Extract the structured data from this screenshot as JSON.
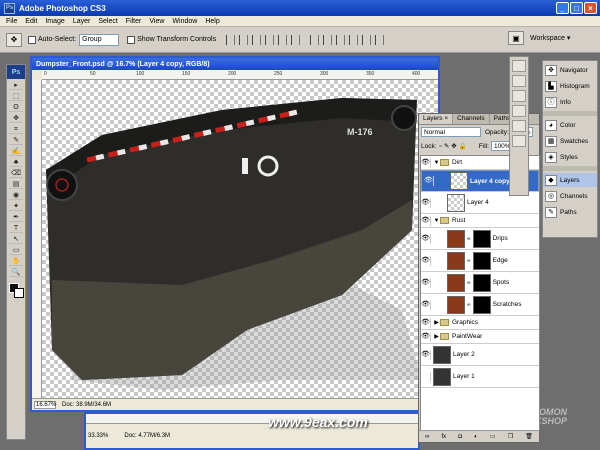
{
  "app": {
    "title": "Adobe Photoshop CS3",
    "badge": "Ps"
  },
  "window_controls": {
    "minimize": "_",
    "maximize": "□",
    "close": "×"
  },
  "menu": [
    "File",
    "Edit",
    "Image",
    "Layer",
    "Select",
    "Filter",
    "View",
    "Window",
    "Help"
  ],
  "options": {
    "auto_select_label": "Auto-Select:",
    "auto_select_value": "Group",
    "transform_label": "Show Transform Controls",
    "workspace_label": "Workspace ▾"
  },
  "document": {
    "title": "Dumpster_Front.psd @ 16.7% (Layer 4 copy, RGB/8)",
    "zoom": "16.67%",
    "doc_size": "Doc: 38.9M/34.6M",
    "ruler_ticks": [
      "0",
      "50",
      "100",
      "150",
      "200",
      "250",
      "300",
      "350",
      "400"
    ],
    "decal_text": "M-176"
  },
  "document2": {
    "zoom": "33.33%",
    "doc_size": "Doc: 4.77M/6.3M"
  },
  "watermark": {
    "site": "www.9eax.com",
    "brand_line1": "THE GNOMON",
    "brand_line2": "WORKSHOP"
  },
  "layers_panel": {
    "tabs": [
      "Layers ×",
      "Channels",
      "Paths"
    ],
    "blend_mode": "Normal",
    "opacity_label": "Opacity:",
    "opacity_value": "100%",
    "lock_label": "Lock:",
    "fill_label": "Fill:",
    "fill_value": "100%",
    "items": [
      {
        "name": "Dirt",
        "kind": "group",
        "open": true
      },
      {
        "name": "Layer 4 copy",
        "kind": "layer",
        "selected": true,
        "thumb": "trans"
      },
      {
        "name": "Layer 4",
        "kind": "layer",
        "thumb": "trans"
      },
      {
        "name": "Rust",
        "kind": "group",
        "open": true
      },
      {
        "name": "Drips",
        "kind": "masked",
        "thumb": "rust"
      },
      {
        "name": "Edge",
        "kind": "masked",
        "thumb": "rust"
      },
      {
        "name": "Spots",
        "kind": "masked",
        "thumb": "rust"
      },
      {
        "name": "Scratches",
        "kind": "masked",
        "thumb": "rust"
      },
      {
        "name": "Graphics",
        "kind": "group",
        "open": false
      },
      {
        "name": "PaintWear",
        "kind": "group",
        "open": false
      },
      {
        "name": "Layer 2",
        "kind": "layer",
        "thumb": "dark"
      },
      {
        "name": "Layer 1",
        "kind": "layer",
        "thumb": "dark",
        "hidden": true
      }
    ]
  },
  "dock": [
    {
      "label": "Navigator",
      "icon": "navigator-icon"
    },
    {
      "label": "Histogram",
      "icon": "histogram-icon"
    },
    {
      "label": "Info",
      "icon": "info-icon"
    },
    {
      "label": "Color",
      "icon": "color-icon"
    },
    {
      "label": "Swatches",
      "icon": "swatches-icon"
    },
    {
      "label": "Styles",
      "icon": "styles-icon"
    },
    {
      "label": "Layers",
      "icon": "layers-icon",
      "active": true
    },
    {
      "label": "Channels",
      "icon": "channels-icon"
    },
    {
      "label": "Paths",
      "icon": "paths-icon"
    }
  ],
  "tools": [
    "▸",
    "⬚",
    "ʘ",
    "✥",
    "⌗",
    "✎",
    "✍",
    "♣",
    "⌫",
    "▤",
    "◉",
    "✦",
    "✒",
    "T",
    "↖",
    "▭",
    "✋",
    "🔍"
  ],
  "colors": {
    "titlebar": "#0a3ab0",
    "panel": "#d4d0c8",
    "selection": "#3469c8"
  }
}
